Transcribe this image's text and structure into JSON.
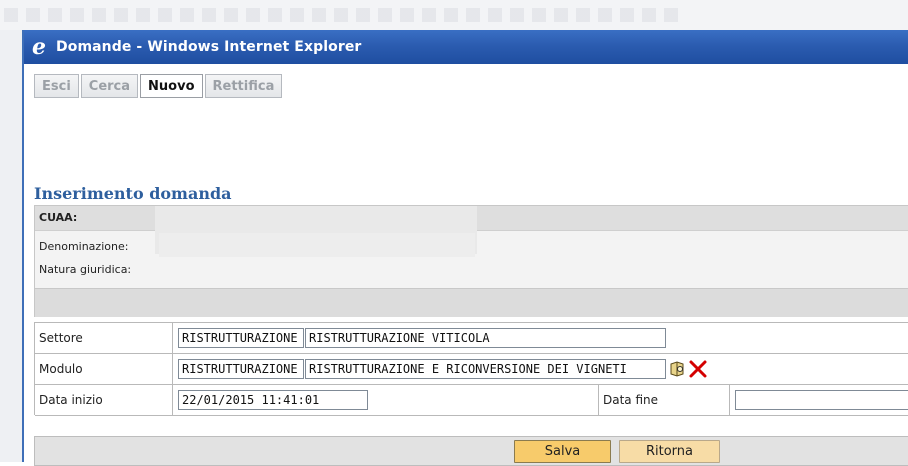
{
  "window": {
    "title": "Domande - Windows Internet Explorer"
  },
  "tabs": [
    {
      "label": "Esci",
      "active": false
    },
    {
      "label": "Cerca",
      "active": false
    },
    {
      "label": "Nuovo",
      "active": true
    },
    {
      "label": "Rettifica",
      "active": false
    }
  ],
  "page": {
    "heading": "Inserimento domanda"
  },
  "info": {
    "cuaa_label": "CUAA:",
    "denominazione_label": "Denominazione:",
    "natura_label": "Natura giuridica:"
  },
  "form": {
    "settore": {
      "label": "Settore",
      "code": "RISTRUTTURAZIONE",
      "description": "RISTRUTTURAZIONE VITICOLA"
    },
    "modulo": {
      "label": "Modulo",
      "code": "RISTRUTTURAZIONE",
      "description": "RISTRUTTURAZIONE E RICONVERSIONE DEI VIGNETI"
    },
    "data_inizio": {
      "label": "Data inizio",
      "value": "22/01/2015 11:41:01"
    },
    "data_fine": {
      "label": "Data fine",
      "value": ""
    }
  },
  "actions": {
    "save_label": "Salva",
    "back_label": "Ritorna"
  },
  "icons": {
    "app": "internet-explorer-icon",
    "pick": "book-search-icon",
    "delete": "red-x-icon"
  },
  "colors": {
    "titlebar": "#2b5cb0",
    "heading": "#2e5f9e",
    "save_button": "#f7cb6b",
    "back_button": "#f7dca6",
    "delete": "#d40000"
  }
}
